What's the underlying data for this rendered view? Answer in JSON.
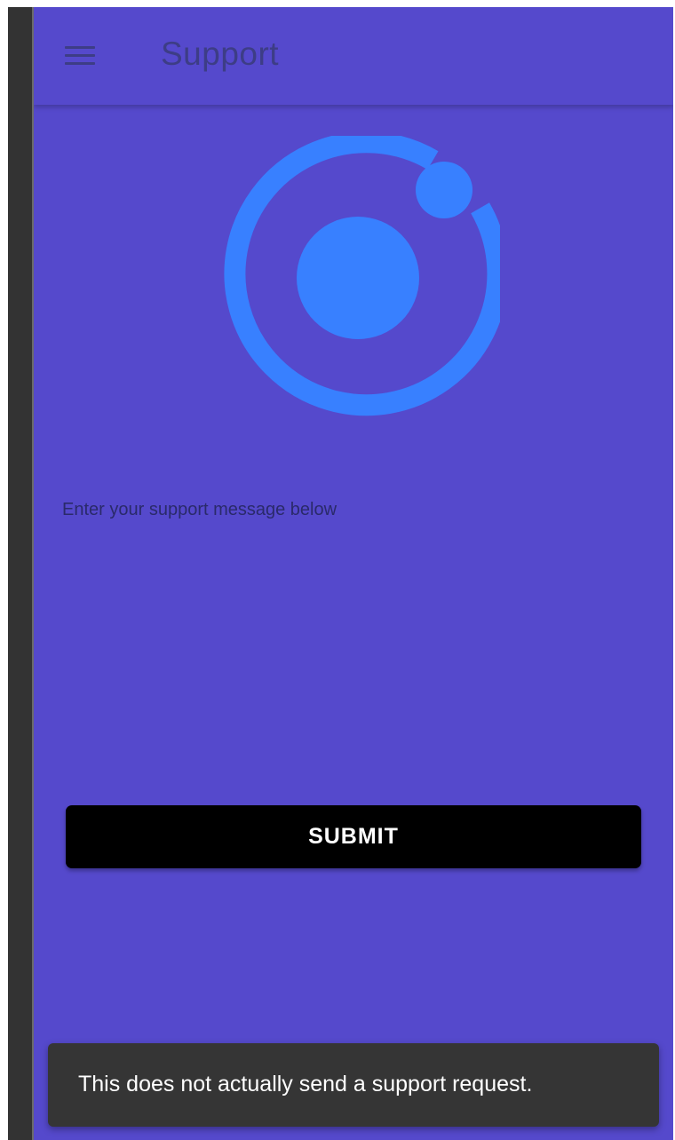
{
  "header": {
    "title": "Support",
    "menu_icon": "menu-icon"
  },
  "logo": {
    "icon": "ionic-logo-icon",
    "color": "#3880ff"
  },
  "form": {
    "message_label": "Enter your support message below",
    "message_value": "",
    "submit_label": "SUBMIT"
  },
  "toast": {
    "message": "This does not actually send a support request."
  },
  "colors": {
    "background": "#5549cc",
    "title_text": "#3d3d86",
    "button": "#000000",
    "toast": "#353535"
  }
}
